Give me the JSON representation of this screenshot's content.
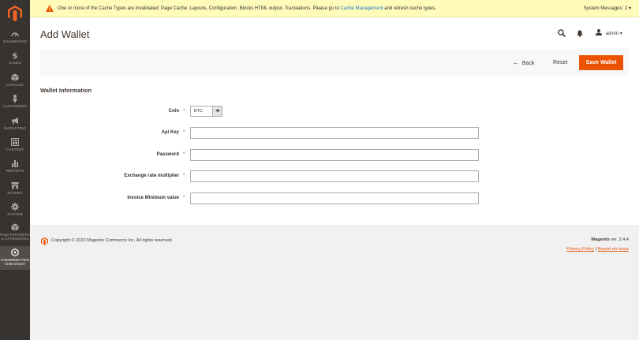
{
  "sidebar": {
    "items": [
      {
        "label": "DASHBOARD",
        "icon": "dashboard-icon"
      },
      {
        "label": "SALES",
        "icon": "dollar-icon"
      },
      {
        "label": "CATALOG",
        "icon": "cube-icon"
      },
      {
        "label": "CUSTOMERS",
        "icon": "person-icon"
      },
      {
        "label": "MARKETING",
        "icon": "megaphone-icon"
      },
      {
        "label": "CONTENT",
        "icon": "layout-icon"
      },
      {
        "label": "REPORTS",
        "icon": "bar-chart-icon"
      },
      {
        "label": "STORES",
        "icon": "store-icon"
      },
      {
        "label": "SYSTEM",
        "icon": "gear-icon"
      },
      {
        "label": "FIND PARTNERS",
        "label2": "& EXTENSIONS",
        "icon": "box-icon"
      },
      {
        "label": "COINREMITTER",
        "label2": "CHECKOUT",
        "icon": "hexagon-icon"
      }
    ]
  },
  "notice": {
    "text": "One or more of the Cache Types are invalidated: Page Cache, Layouts, Configuration, Blocks HTML output, Translations. Please go to ",
    "link": "Cache Management",
    "text_after": " and refresh cache types.",
    "system_messages": "System Messages: 2"
  },
  "header": {
    "title": "Add Wallet",
    "user": "admin"
  },
  "actions": {
    "back": "Back",
    "reset": "Reset",
    "save": "Save Wallet"
  },
  "form": {
    "section_title": "Wallet Information",
    "coin_label": "Coin",
    "coin_value": "BTC",
    "api_key_label": "Api Key",
    "password_label": "Password",
    "exchange_label": "Exchange rate multiplier",
    "invoice_label": "Invoice Minimum value",
    "required_mark": "*"
  },
  "footer": {
    "copyright": "Copyright © 2022 Magento Commerce Inc. All rights reserved.",
    "brand": "Magento",
    "version": " ver. 2.4.4",
    "privacy": "Privacy Policy",
    "separator": " | ",
    "report": "Report an Issue"
  },
  "colors": {
    "sidebar_bg": "#373330",
    "accent": "#eb5202",
    "notice_bg": "#fffbbb",
    "link": "#1979c3"
  }
}
